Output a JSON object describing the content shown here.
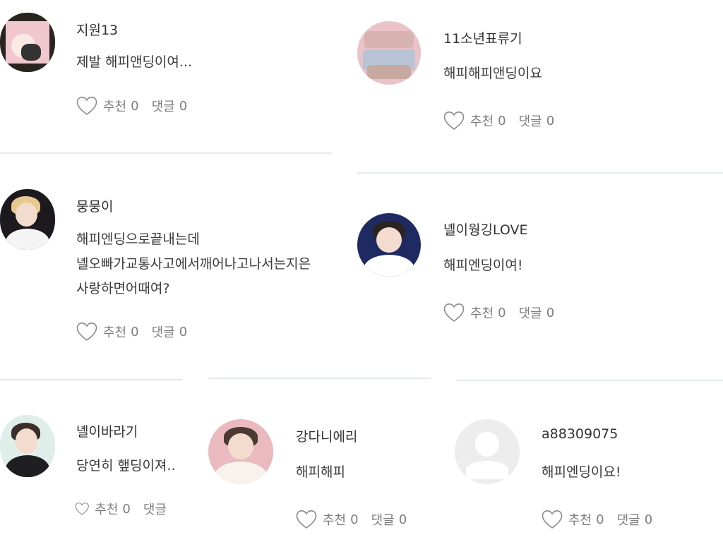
{
  "actions": {
    "recommend_label": "추천",
    "reply_label": "댓글"
  },
  "comments": [
    {
      "username": "지원13",
      "lines": [
        "제발 해피앤딩이여..."
      ],
      "recommend": "0",
      "replies": "0"
    },
    {
      "username": "11소년표류기",
      "lines": [
        "해피해피앤딩이요"
      ],
      "recommend": "0",
      "replies": "0"
    },
    {
      "username": "뭉뭉이",
      "lines": [
        "해피엔딩으로끝내는데",
        "녤오빠가교통사고에서깨어나고나서는지은",
        "사랑하면어때여?"
      ],
      "recommend": "0",
      "replies": "0"
    },
    {
      "username": "녤이웡깅LOVE",
      "lines": [
        "해피엔딩이여!"
      ],
      "recommend": "0",
      "replies": "0"
    },
    {
      "username": "녤이바라기",
      "lines": [
        "당연히 햎딩이져.."
      ],
      "recommend": "0",
      "replies": ""
    },
    {
      "username": "강다니에리",
      "lines": [
        "해피해피"
      ],
      "recommend": "0",
      "replies": "0"
    },
    {
      "username": "a88309075",
      "lines": [
        "해피엔딩이요!"
      ],
      "recommend": "0",
      "replies": "0"
    }
  ],
  "colors": {
    "text": "#333333",
    "muted": "#7d7d7d",
    "divider": "#e3e9ec",
    "heart_stroke": "#8a8a8a"
  },
  "icons": {
    "like": "heart-outline-icon",
    "default_avatar": "default-user-icon"
  }
}
